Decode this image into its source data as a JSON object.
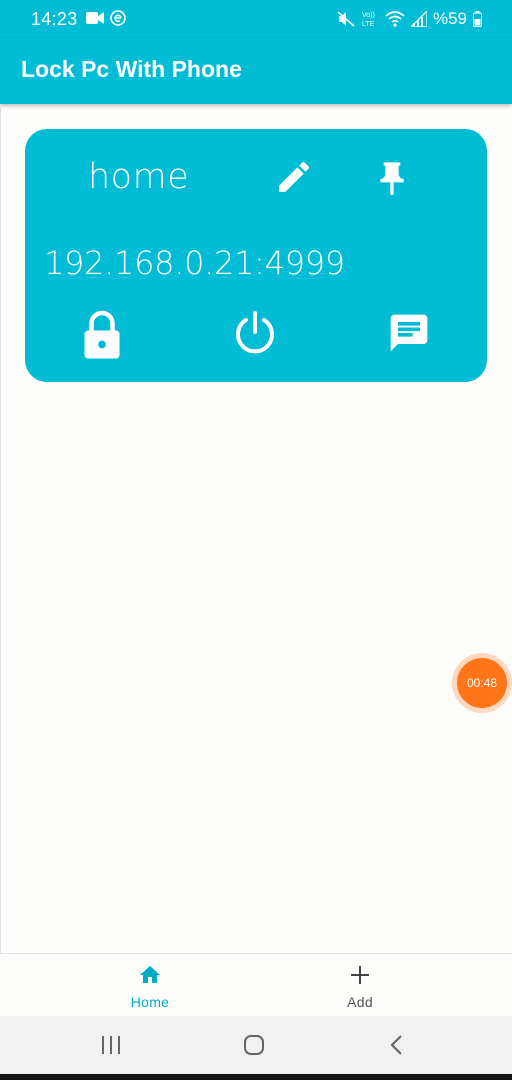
{
  "status_bar": {
    "time": "14:23",
    "battery": "%59",
    "left_icons": [
      "video-camera-icon",
      "e-badge-icon"
    ],
    "right_icons": [
      "mute-icon",
      "volte-icon",
      "wifi-icon",
      "signal-icon",
      "battery-icon"
    ],
    "volte_label_top": "Vo))",
    "volte_label_bottom": "LTE"
  },
  "app_bar": {
    "title": "Lock Pc With Phone"
  },
  "device_card": {
    "name": "home",
    "address": "192.168.0.21:4999",
    "actions": [
      "edit-icon",
      "pin-icon",
      "lock-icon",
      "power-icon",
      "message-icon"
    ]
  },
  "floating_timer": {
    "text": "00:48"
  },
  "bottom_nav": {
    "items": [
      {
        "label": "Home",
        "icon": "home-icon",
        "active": true
      },
      {
        "label": "Add",
        "icon": "plus-icon",
        "active": false
      }
    ]
  },
  "colors": {
    "primary": "#00bcd4",
    "active_nav": "#00acc1",
    "timer": "#ff7518",
    "background": "#fdfdfb"
  }
}
